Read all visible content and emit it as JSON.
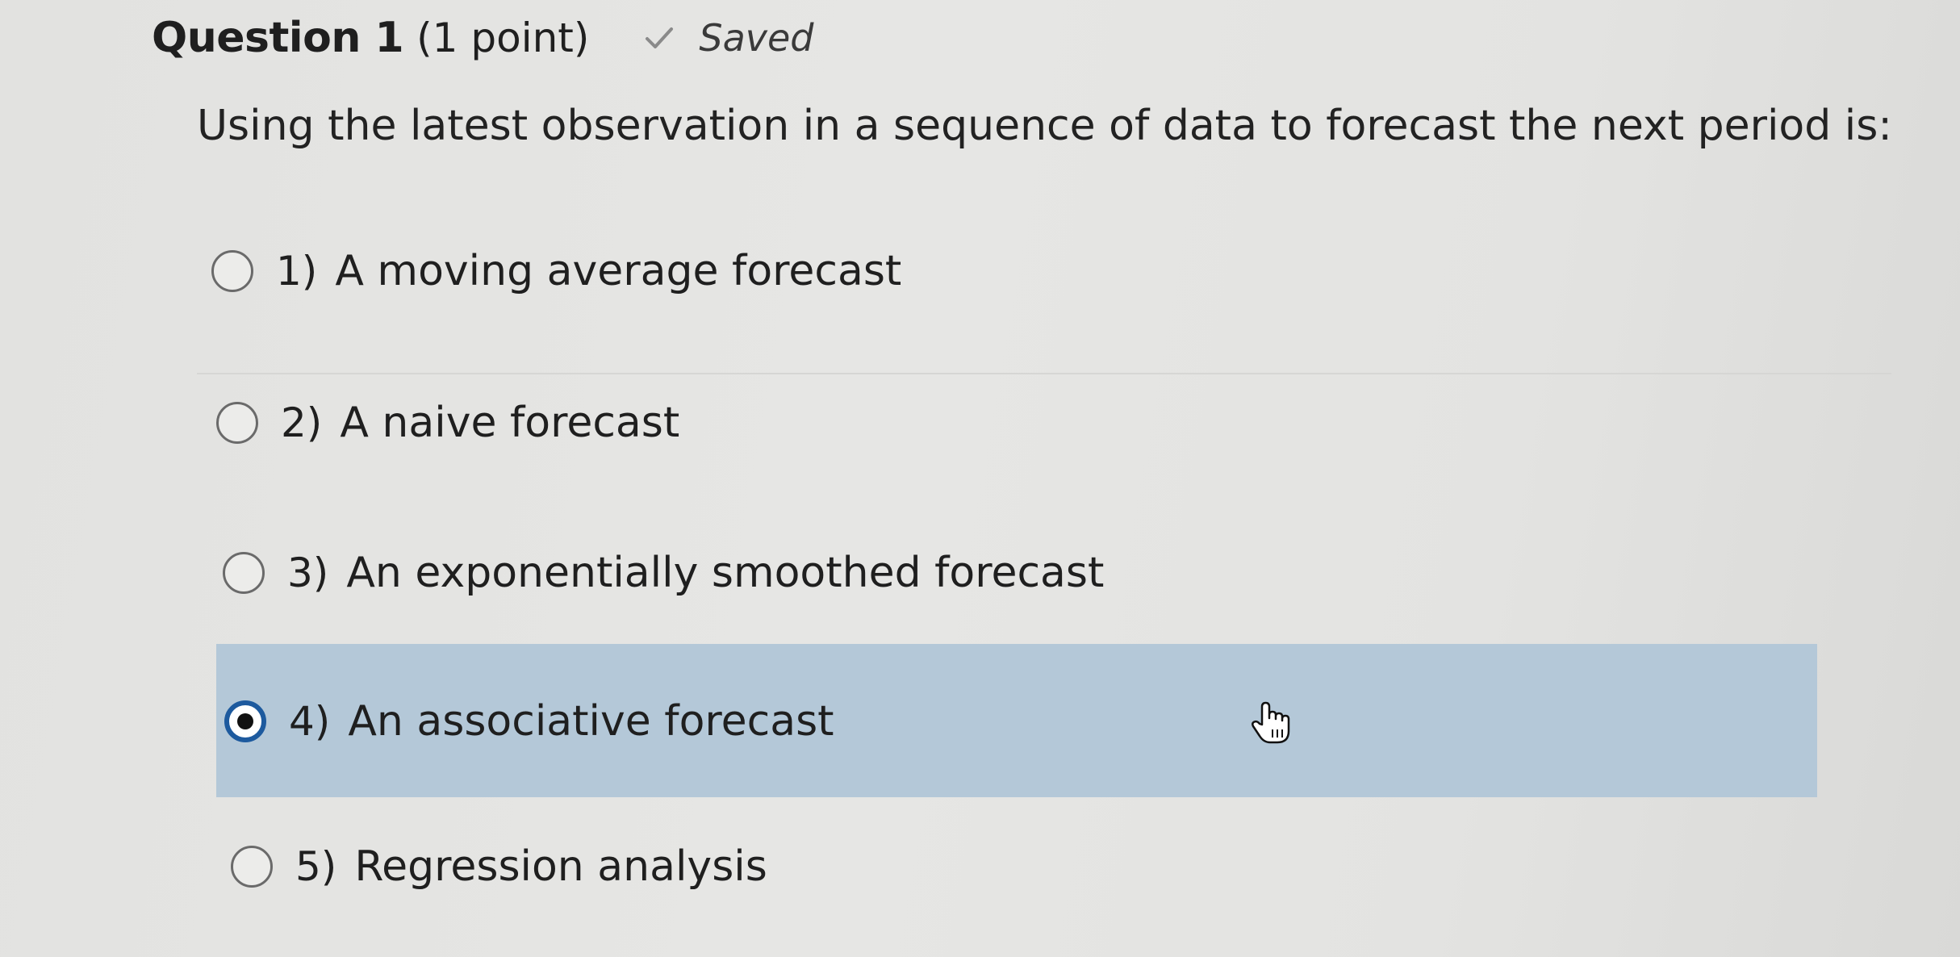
{
  "header": {
    "question_title": "Question 1",
    "points": "(1 point)",
    "status_icon": "check-icon",
    "status_text": "Saved"
  },
  "question": {
    "prompt": "Using the latest observation in a sequence of data to forecast the next period is:"
  },
  "options": [
    {
      "number": "1)",
      "label": "A moving average forecast",
      "selected": false
    },
    {
      "number": "2)",
      "label": "A naive forecast",
      "selected": false
    },
    {
      "number": "3)",
      "label": "An exponentially smoothed forecast",
      "selected": false
    },
    {
      "number": "4)",
      "label": "An associative forecast",
      "selected": true
    },
    {
      "number": "5)",
      "label": "Regression analysis",
      "selected": false
    }
  ],
  "colors": {
    "selected_highlight": "#b4c8d8",
    "radio_selected_ring": "#1d5a9e"
  }
}
